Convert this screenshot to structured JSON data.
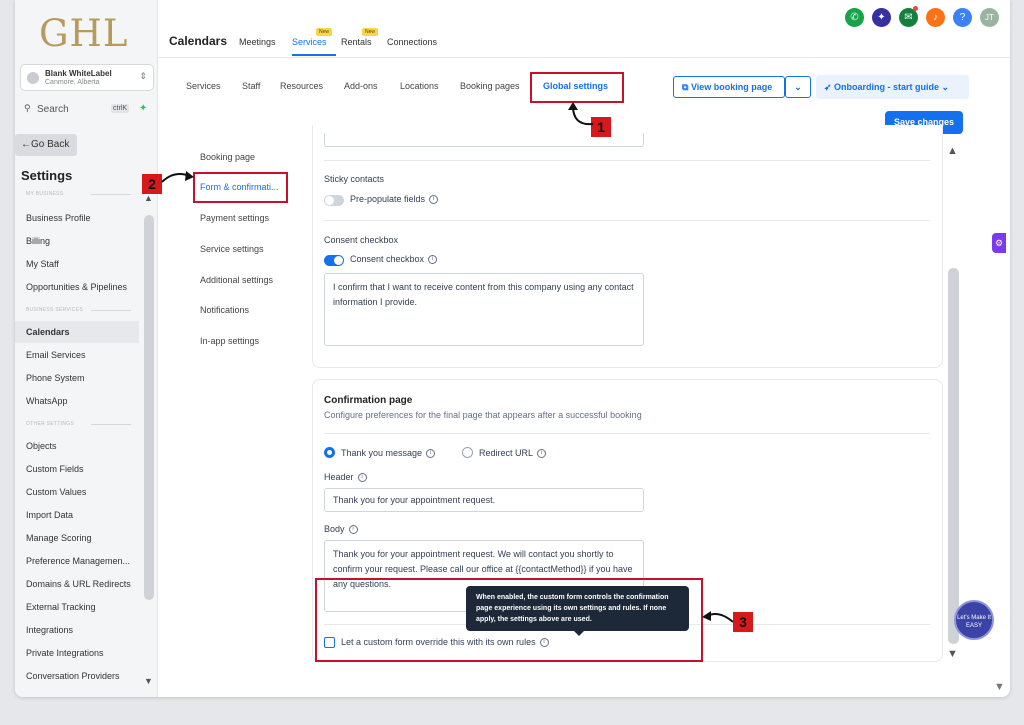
{
  "logo": "GHL",
  "account": {
    "name": "Blank WhiteLabel",
    "location": "Canmore, Alberta"
  },
  "search": {
    "placeholder": "Search",
    "shortcut": "ctrlK"
  },
  "go_back": "Go Back",
  "settings_title": "Settings",
  "sidebar": {
    "section_my_business": "MY BUSINESS",
    "section_business_services": "BUSINESS SERVICES",
    "section_other_settings": "OTHER SETTINGS",
    "items": [
      "Business Profile",
      "Billing",
      "My Staff",
      "Opportunities & Pipelines",
      "Calendars",
      "Email Services",
      "Phone System",
      "WhatsApp",
      "Objects",
      "Custom Fields",
      "Custom Values",
      "Import Data",
      "Manage Scoring",
      "Preference Managemen...",
      "Domains & URL Redirects",
      "External Tracking",
      "Integrations",
      "Private Integrations",
      "Conversation Providers"
    ],
    "active": "Calendars"
  },
  "header": {
    "title": "Calendars",
    "tabs": [
      "Meetings",
      "Services",
      "Rentals",
      "Connections"
    ],
    "active_tab": "Services",
    "badge_new": "New",
    "avatar": "JT"
  },
  "subnav": {
    "tabs": [
      "Services",
      "Staff",
      "Resources",
      "Add-ons",
      "Locations",
      "Booking pages",
      "Global settings"
    ],
    "active": "Global settings",
    "view_booking_page": "View booking page",
    "onboarding": "Onboarding - start guide",
    "save": "Save changes"
  },
  "left_menu": {
    "items": [
      "Booking page",
      "Form & confirmati...",
      "Payment settings",
      "Service settings",
      "Additional settings",
      "Notifications",
      "In-app settings"
    ],
    "active": "Form & confirmati..."
  },
  "sticky": {
    "title": "Sticky contacts",
    "label": "Pre-populate fields",
    "enabled": false
  },
  "consent": {
    "title": "Consent checkbox",
    "label": "Consent checkbox",
    "enabled": true,
    "text": "I confirm that I want to receive content from this company using any contact information I provide."
  },
  "confirmation": {
    "title": "Confirmation page",
    "subtitle": "Configure preferences for the final page that appears after a successful booking",
    "option_thank_you": "Thank you message",
    "option_redirect": "Redirect URL",
    "selected": "Thank you message",
    "header_label": "Header",
    "header_value": "Thank you for your appointment request.",
    "body_label": "Body",
    "body_value": "Thank you for your appointment request. We will contact you shortly to confirm your request. Please call our office at {{contactMethod}} if you have any questions.",
    "override_label": "Let a custom form override this with its own rules",
    "tooltip": "When enabled, the custom form controls the confirmation page experience using its own settings and rules. If none apply, the settings above are used."
  },
  "annotations": [
    "1",
    "2",
    "3"
  ],
  "widget_text": "Let's Make It EASY",
  "colors": {
    "accent": "#1570ef",
    "annotation": "#c8102e",
    "logo": "#b79a5c"
  }
}
